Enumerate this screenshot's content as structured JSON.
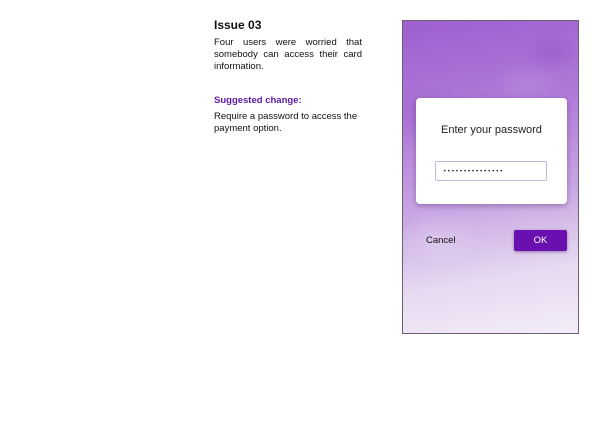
{
  "issue": {
    "title": "Issue 03",
    "description": "Four users were worried that somebody can access their card information.",
    "suggested_label": "Suggested change:",
    "suggested_text": "Require a password to access the payment option."
  },
  "dialog": {
    "title": "Enter your password",
    "password_value": "•••••••••••••••",
    "cancel_label": "Cancel",
    "ok_label": "OK"
  },
  "colors": {
    "accent": "#6a0fb0",
    "heading_purple": "#5b1aa6"
  }
}
